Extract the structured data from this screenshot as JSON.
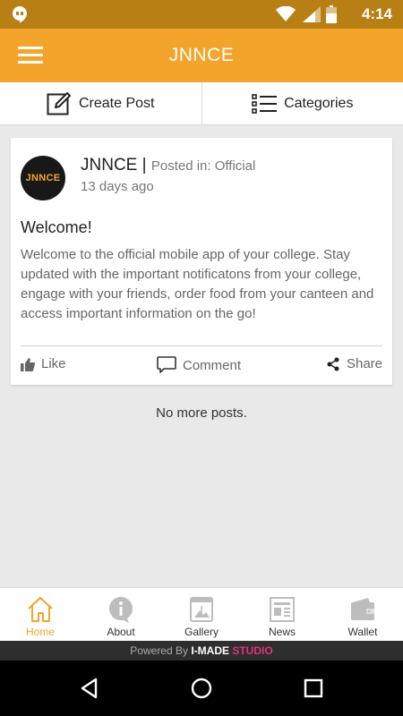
{
  "status_bar": {
    "time": "4:14"
  },
  "app_bar": {
    "title": "JNNCE"
  },
  "actions": {
    "create_post": "Create Post",
    "categories": "Categories"
  },
  "post": {
    "avatar_text": "JNNCE",
    "author": "JNNCE",
    "separator": " | ",
    "posted_in": "Posted in: Official",
    "time_ago": "13 days ago",
    "title": "Welcome!",
    "body": "Welcome to the official mobile app of your college. Stay updated with the important notificatons from your college, engage with your friends, order food from your canteen and access important information on the go!",
    "like": "Like",
    "comment": "Comment",
    "share": "Share"
  },
  "feed": {
    "end_text": "No more posts."
  },
  "tabs": [
    {
      "label": "Home",
      "icon": "home-icon",
      "active": true
    },
    {
      "label": "About",
      "icon": "info-icon",
      "active": false
    },
    {
      "label": "Gallery",
      "icon": "gallery-icon",
      "active": false
    },
    {
      "label": "News",
      "icon": "news-icon",
      "active": false
    },
    {
      "label": "Wallet",
      "icon": "wallet-icon",
      "active": false
    }
  ],
  "footer": {
    "powered_by": "Powered By ",
    "brand_a": "I-MADE ",
    "brand_b": "STUDIO"
  },
  "colors": {
    "primary": "#f2a42b",
    "status_bar": "#b87f14",
    "text_muted": "#777777"
  }
}
